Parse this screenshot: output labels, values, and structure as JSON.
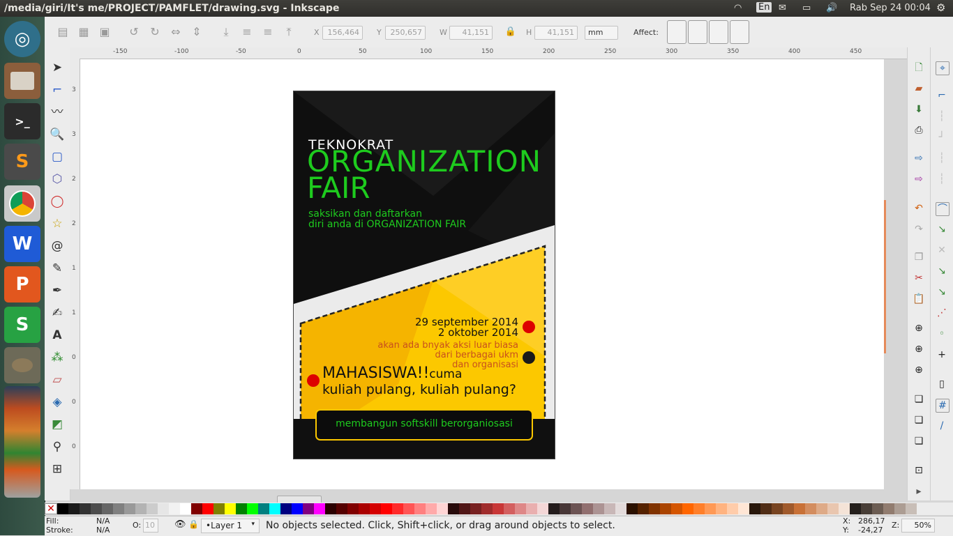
{
  "window": {
    "title": "/media/giri/It's me/PROJECT/PAMFLET/drawing.svg - Inkscape"
  },
  "tray": {
    "lang": "En",
    "clock": "Rab Sep 24 00:04"
  },
  "launcher": [
    {
      "name": "ubuntu-dash-icon",
      "label": ""
    },
    {
      "name": "files-icon",
      "label": ""
    },
    {
      "name": "terminal-icon",
      "label": ">_"
    },
    {
      "name": "sublime-text-icon",
      "label": "S"
    },
    {
      "name": "chrome-icon",
      "label": ""
    },
    {
      "name": "wps-writer-icon",
      "label": "W"
    },
    {
      "name": "wps-presentation-icon",
      "label": "P"
    },
    {
      "name": "wps-spreadsheets-icon",
      "label": "S"
    },
    {
      "name": "gimp-icon",
      "label": ""
    }
  ],
  "toolbar": {
    "x_label": "X",
    "x_value": "156,464",
    "y_label": "Y",
    "y_value": "250,657",
    "w_label": "W",
    "w_value": "41,151",
    "h_label": "H",
    "h_value": "41,151",
    "unit": "mm",
    "affect_label": "Affect:"
  },
  "ruler": {
    "h_ticks": [
      "-150",
      "-100",
      "-50",
      "0",
      "50",
      "100",
      "150",
      "200",
      "250",
      "300",
      "350",
      "400",
      "450"
    ],
    "v_ticks": [
      "3",
      "3",
      "2",
      "2",
      "1",
      "1",
      "0",
      "0",
      "0"
    ]
  },
  "poster": {
    "kicker": "TEKNOKRAT",
    "title_line1": "ORGANIZATION",
    "title_line2": "FAIR",
    "subtitle_line1": "saksikan dan daftarkan",
    "subtitle_line2": "diri anda di ORGANIZATION FAIR",
    "date1": "29 september 2014",
    "date2": "2 oktober 2014",
    "info1": "akan ada bnyak aksi luar biasa",
    "info2": "dari berbagai ukm",
    "info3": "dan organisasi",
    "headline": "MAHASISWA!!",
    "headline_tail": "cuma",
    "question": "kuliah pulang, kuliah pulang?",
    "banner": "membangun softskill berorganiosasi",
    "colors": {
      "green": "#1ecb1e",
      "yellow": "#fcc800",
      "red": "#dd0000"
    }
  },
  "status": {
    "fill_label": "Fill:",
    "fill_value": "N/A",
    "stroke_label": "Stroke:",
    "stroke_value": "N/A",
    "opacity_label": "O:",
    "opacity_value": "10",
    "layer": "•Layer 1",
    "message": "No objects selected. Click, Shift+click, or drag around objects to select.",
    "x_label": "X:",
    "x_value": "286,17",
    "y_label": "Y:",
    "y_value": "-24,27",
    "zoom_label": "Z:",
    "zoom_value": "50%"
  },
  "palette_colors": [
    "#000000",
    "#1a1a1a",
    "#333333",
    "#4d4d4d",
    "#666666",
    "#808080",
    "#999999",
    "#b3b3b3",
    "#cccccc",
    "#e6e6e6",
    "#f2f2f2",
    "#ffffff",
    "#800000",
    "#ff0000",
    "#808000",
    "#ffff00",
    "#008000",
    "#00ff00",
    "#008080",
    "#00ffff",
    "#000080",
    "#0000ff",
    "#800080",
    "#ff00ff",
    "#2b0000",
    "#550000",
    "#800000",
    "#aa0000",
    "#d40000",
    "#ff0000",
    "#ff2a2a",
    "#ff5555",
    "#ff8080",
    "#ffaaaa",
    "#ffd5d5",
    "#280b0b",
    "#501616",
    "#782121",
    "#a02c2c",
    "#c83737",
    "#d35f5f",
    "#de8787",
    "#e9afaf",
    "#f4d7d7",
    "#241c1c",
    "#483737",
    "#6c5353",
    "#916f6f",
    "#ac9393",
    "#c8b7b7",
    "#e3dbdb",
    "#2b1100",
    "#552200",
    "#803300",
    "#aa4400",
    "#d45500",
    "#ff6600",
    "#ff7f2a",
    "#ff9955",
    "#ffb380",
    "#ffccaa",
    "#ffe6d5",
    "#28170b",
    "#502d16",
    "#784421",
    "#a05a2c",
    "#c87137",
    "#d38d5f",
    "#deaa87",
    "#e9c6af",
    "#f4e3d7",
    "#241f1c",
    "#483e37",
    "#6c5d53",
    "#917c6f",
    "#ac9d93",
    "#c8beb7"
  ]
}
